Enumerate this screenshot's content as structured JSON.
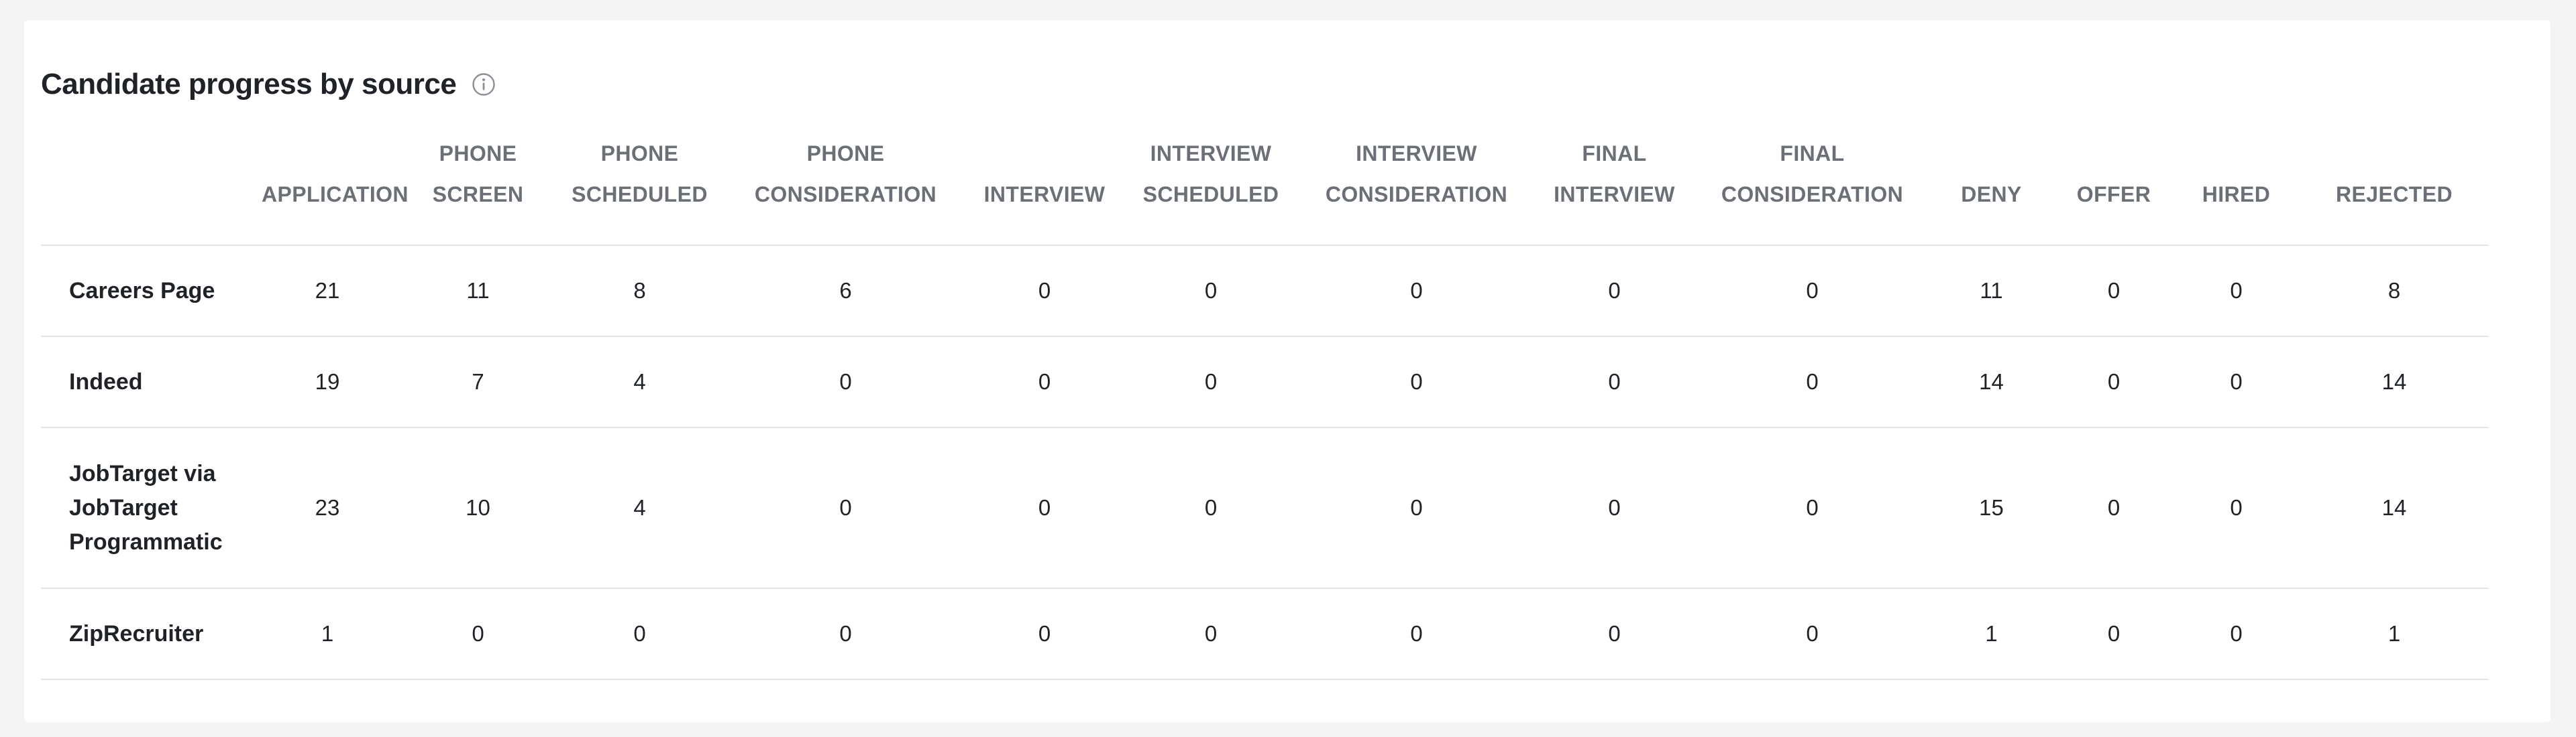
{
  "title": "Candidate progress by source",
  "icons": {
    "info": "info-icon"
  },
  "columns": [
    {
      "line1": "",
      "line2": "APPLICATION"
    },
    {
      "line1": "PHONE",
      "line2": "SCREEN"
    },
    {
      "line1": "PHONE",
      "line2": "SCHEDULED"
    },
    {
      "line1": "PHONE",
      "line2": "CONSIDERATION"
    },
    {
      "line1": "",
      "line2": "INTERVIEW"
    },
    {
      "line1": "INTERVIEW",
      "line2": "SCHEDULED"
    },
    {
      "line1": "INTERVIEW",
      "line2": "CONSIDERATION"
    },
    {
      "line1": "FINAL",
      "line2": "INTERVIEW"
    },
    {
      "line1": "FINAL",
      "line2": "CONSIDERATION"
    },
    {
      "line1": "",
      "line2": "DENY"
    },
    {
      "line1": "",
      "line2": "OFFER"
    },
    {
      "line1": "",
      "line2": "HIRED"
    },
    {
      "line1": "",
      "line2": "REJECTED"
    }
  ],
  "rows": [
    {
      "source": "Careers Page",
      "values": [
        "21",
        "11",
        "8",
        "6",
        "0",
        "0",
        "0",
        "0",
        "0",
        "11",
        "0",
        "0",
        "8"
      ]
    },
    {
      "source": "Indeed",
      "values": [
        "19",
        "7",
        "4",
        "0",
        "0",
        "0",
        "0",
        "0",
        "0",
        "14",
        "0",
        "0",
        "14"
      ]
    },
    {
      "source": "JobTarget via JobTarget Programmatic",
      "source_lines": [
        "JobTarget via",
        "JobTarget",
        "Programmatic"
      ],
      "values": [
        "23",
        "10",
        "4",
        "0",
        "0",
        "0",
        "0",
        "0",
        "0",
        "15",
        "0",
        "0",
        "14"
      ]
    },
    {
      "source": "ZipRecruiter",
      "values": [
        "1",
        "0",
        "0",
        "0",
        "0",
        "0",
        "0",
        "0",
        "0",
        "1",
        "0",
        "0",
        "1"
      ]
    }
  ]
}
